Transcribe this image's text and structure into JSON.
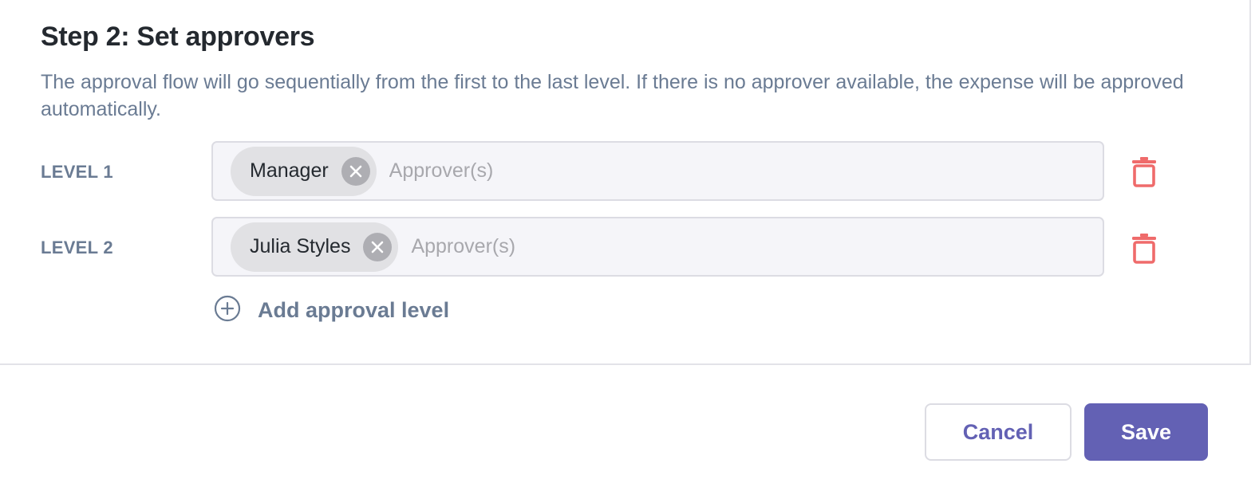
{
  "step": {
    "title": "Step 2: Set approvers",
    "description": "The approval flow will go sequentially from the first to the last level. If there is no approver available, the expense will be approved automatically."
  },
  "levels": [
    {
      "label": "LEVEL 1",
      "approver": "Manager",
      "placeholder": "Approver(s)"
    },
    {
      "label": "LEVEL 2",
      "approver": "Julia Styles",
      "placeholder": "Approver(s)"
    }
  ],
  "add_level": {
    "label": "Add approval level",
    "icon": "plus-circle-icon"
  },
  "footer": {
    "cancel_label": "Cancel",
    "save_label": "Save"
  },
  "colors": {
    "accent": "#6361b4",
    "delete": "#ef6b6b",
    "muted_text": "#6a7b93",
    "chip_bg": "#e1e1e4",
    "field_bg": "#f5f5f9"
  }
}
